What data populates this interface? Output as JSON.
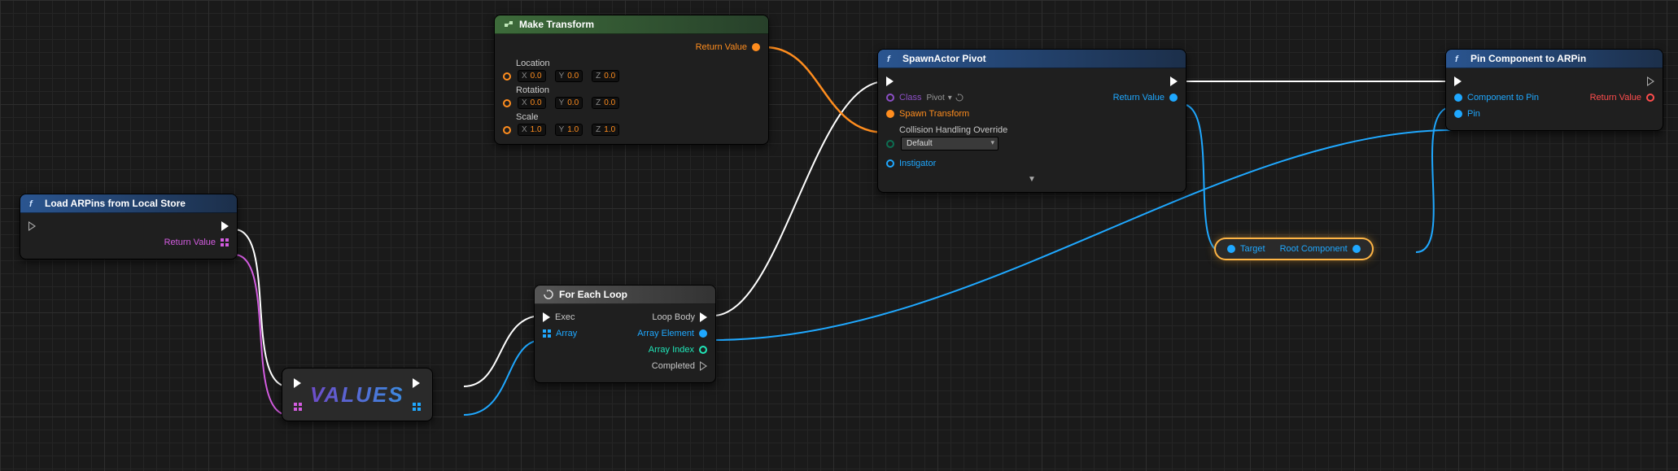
{
  "nodes": {
    "load_arpins": {
      "title": "Load ARPins from Local Store",
      "return_label": "Return Value"
    },
    "make_transform": {
      "title": "Make Transform",
      "return_label": "Return Value",
      "location_label": "Location",
      "rotation_label": "Rotation",
      "scale_label": "Scale",
      "loc": {
        "x": "0.0",
        "y": "0.0",
        "z": "0.0"
      },
      "rot": {
        "x": "0.0",
        "y": "0.0",
        "z": "0.0"
      },
      "scl": {
        "x": "1.0",
        "y": "1.0",
        "z": "1.0"
      }
    },
    "foreach": {
      "title": "For Each Loop",
      "exec_label": "Exec",
      "array_label": "Array",
      "loop_body_label": "Loop Body",
      "element_label": "Array Element",
      "index_label": "Array Index",
      "completed_label": "Completed"
    },
    "spawn": {
      "title": "SpawnActor Pivot",
      "class_label": "Class",
      "class_value": "Pivot",
      "spawn_transform_label": "Spawn Transform",
      "collision_label": "Collision Handling Override",
      "collision_value": "Default",
      "instigator_label": "Instigator",
      "return_label": "Return Value"
    },
    "pin_component": {
      "title": "Pin Component to ARPin",
      "component_label": "Component to Pin",
      "pin_label": "Pin",
      "return_label": "Return Value"
    },
    "getter": {
      "target_label": "Target",
      "root_label": "Root Component"
    },
    "values_label": "VALUES"
  }
}
